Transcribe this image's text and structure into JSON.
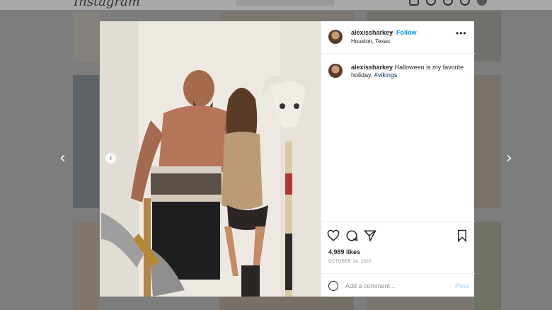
{
  "app": {
    "logo": "Instagram"
  },
  "post": {
    "username": "alexissharkey",
    "follow_label": "Follow",
    "separator": "•",
    "location": "Houston, Texas",
    "more_label": "•••",
    "caption": {
      "username": "alexissharkey",
      "text": " Halloween is my favorite holiday. ",
      "hashtag": "#vikings"
    },
    "likes": "4,989 likes",
    "date": "OCTOBER 24, 2020",
    "comment_placeholder": "Add a comment...",
    "post_label": "Post",
    "carousel_prev": "‹"
  },
  "nav": {
    "prev": "‹",
    "next": "›"
  },
  "icons": [
    "heart-icon",
    "comment-icon",
    "share-icon",
    "bookmark-icon",
    "emoji-icon",
    "more-icon"
  ],
  "colors": {
    "follow": "#0095f6",
    "post_disabled": "#b2dffc",
    "hashtag": "#00376b"
  }
}
